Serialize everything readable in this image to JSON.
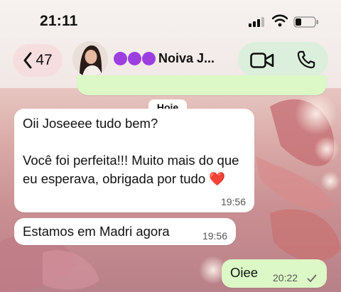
{
  "status_bar": {
    "time": "21:11"
  },
  "header": {
    "back_count": "47",
    "contact_name": "Noiva J...",
    "contact_emojis": [
      "purple-circle",
      "purple-circle",
      "purple-circle"
    ]
  },
  "date_chip": "Hoje",
  "messages": [
    {
      "direction": "incoming",
      "text": "Oii Joseeee tudo bem?\n\nVocê foi perfeita!!! Muito mais do que eu esperava, obrigada por tudo ❤️",
      "time": "19:56"
    },
    {
      "direction": "incoming",
      "text": "Estamos em Madri agora",
      "time": "19:56"
    },
    {
      "direction": "outgoing",
      "text": "Oiee",
      "time": "20:22",
      "status": "delivered-check"
    }
  ],
  "colors": {
    "outgoing_bubble": "#dcf8c6",
    "incoming_bubble": "#ffffff",
    "back_pill": "#f6dede",
    "call_pill": "#dcefdc",
    "emoji_purple": "#9c3fe0"
  }
}
